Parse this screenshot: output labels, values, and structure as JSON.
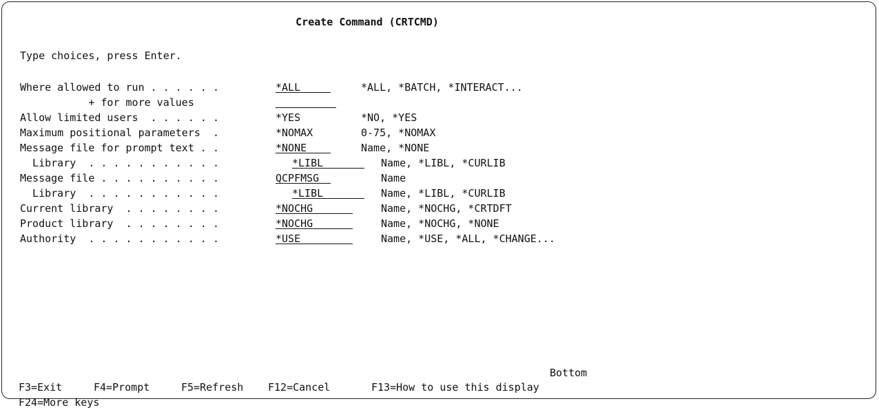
{
  "title": "Create Command (CRTCMD)",
  "instruction": "Type choices, press Enter.",
  "params": [
    {
      "label": "Where allowed to run . . . . . .",
      "value": "*ALL",
      "hint": "*ALL, *BATCH, *INTERACT..."
    },
    {
      "label": "           + for more values",
      "value": "",
      "hint": ""
    },
    {
      "label": "Allow limited users  . . . . . .",
      "value": "*YES",
      "hint": "*NO, *YES"
    },
    {
      "label": "Maximum positional parameters  .",
      "value": "*NOMAX",
      "hint": "0-75, *NOMAX"
    },
    {
      "label": "Message file for prompt text . .",
      "value": "*NONE",
      "hint": "Name, *NONE"
    },
    {
      "label": "  Library  . . . . . . . . . . .",
      "value": "*LIBL",
      "hint": "Name, *LIBL, *CURLIB"
    },
    {
      "label": "Message file . . . . . . . . . .",
      "value": "QCPFMSG",
      "hint": "Name"
    },
    {
      "label": "  Library  . . . . . . . . . . .",
      "value": "*LIBL",
      "hint": "Name, *LIBL, *CURLIB"
    },
    {
      "label": "Current library  . . . . . . . .",
      "value": "*NOCHG",
      "hint": "Name, *NOCHG, *CRTDFT"
    },
    {
      "label": "Product library  . . . . . . . .",
      "value": "*NOCHG",
      "hint": "Name, *NOCHG, *NONE"
    },
    {
      "label": "Authority  . . . . . . . . . . .",
      "value": "*USE",
      "hint": "Name, *USE, *ALL, *CHANGE..."
    }
  ],
  "status": "Bottom",
  "fkeys": {
    "f3": "F3=Exit",
    "f4": "F4=Prompt",
    "f5": "F5=Refresh",
    "f12": "F12=Cancel",
    "f13": "F13=How to use this display",
    "f24": "F24=More keys"
  }
}
